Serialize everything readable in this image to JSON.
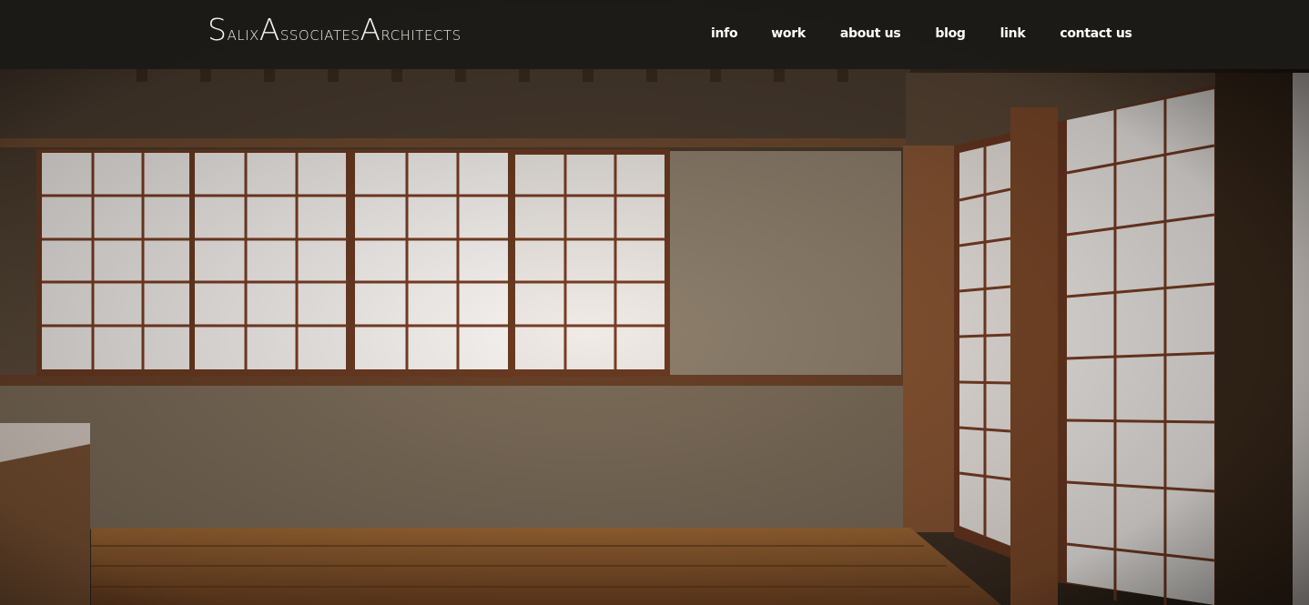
{
  "brand": {
    "words": [
      {
        "cap": "S",
        "rest": "ALIX"
      },
      {
        "cap": "A",
        "rest": "SSOCIATES"
      },
      {
        "cap": "A",
        "rest": "RCHITECTS"
      }
    ]
  },
  "nav": {
    "items": [
      {
        "label": "info"
      },
      {
        "label": "work"
      },
      {
        "label": "about us"
      },
      {
        "label": "blog"
      },
      {
        "label": "link"
      },
      {
        "label": "contact us"
      }
    ]
  },
  "hero": {
    "description_icon": "japanese-room-photo",
    "colors": {
      "wall": "#5e4c3a",
      "wood": "#7a4a2a",
      "paper": "#f7f4ef",
      "floor": "#8a5a2e"
    }
  }
}
